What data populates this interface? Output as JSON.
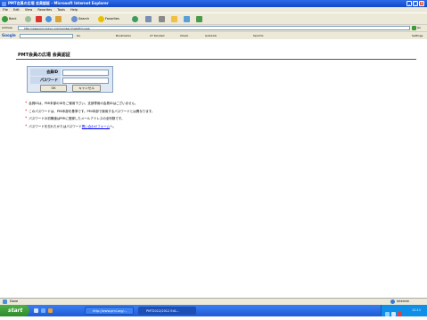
{
  "window": {
    "title": "PMT会員の広場 会員認証 - Microsoft Internet Explorer",
    "minimize": "_",
    "maximize": "□",
    "close": "×"
  },
  "menu": [
    "File",
    "Edit",
    "View",
    "Favorites",
    "Tools",
    "Help"
  ],
  "toolbar": {
    "back": "Back",
    "search": "Search",
    "favorites": "Favorites",
    "back_icon": "back-arrow-icon",
    "forward_icon": "forward-arrow-icon",
    "stop_icon": "stop-icon",
    "refresh_icon": "refresh-icon",
    "home_icon": "home-icon",
    "search_icon": "search-icon",
    "favorites_icon": "star-icon",
    "history_icon": "history-icon",
    "mail_icon": "mail-icon",
    "print_icon": "print-icon"
  },
  "address": {
    "label": "Address",
    "url": "http://www.pmi-tokyo.org/member/jmstafi/ini.asp",
    "go": "Go",
    "links": "Links"
  },
  "googlebar": {
    "label": "Google",
    "go": "Go",
    "bookmarks": "Bookmarks",
    "blocked": "27 blocked",
    "check": "Check",
    "autolink": "AutoLink",
    "sendto": "Send to",
    "settings": "Settings"
  },
  "page": {
    "title": "PMT会員の広場 会員認証",
    "member_id_label": "会員ID",
    "password_label": "パスワード",
    "member_id_value": "",
    "password_value": "",
    "ok_label": "OK",
    "cancel_label": "キャンセル",
    "notes": [
      {
        "text": "会員IDは、PMI本部のIDをご使用下さい。支部専用の会員IDはございません。"
      },
      {
        "text": "このパスワードは、PMI本部を基準です。PMI本部で使用するパスワードとは異なります。"
      },
      {
        "text": "パスワードの初期値はPMIに登録したメールアドレスの全桁数です。"
      },
      {
        "text": "パスワードを忘れたかたはパスワード",
        "link": "問い合わせフォーム",
        "suffix": "へ。"
      }
    ]
  },
  "status": {
    "left": "Done",
    "zone": "Internet"
  },
  "taskbar": {
    "start": "start",
    "task1": "http://www.pmi.org/...",
    "task2": "PMT2012/2012 Ed1...",
    "clock": "12:11"
  },
  "colors": {
    "title_blue": "#1148c9",
    "taskbar_blue": "#1f5bd6",
    "start_green": "#2f8a2b",
    "note_star": "#ee0000",
    "link": "#0000ee"
  }
}
